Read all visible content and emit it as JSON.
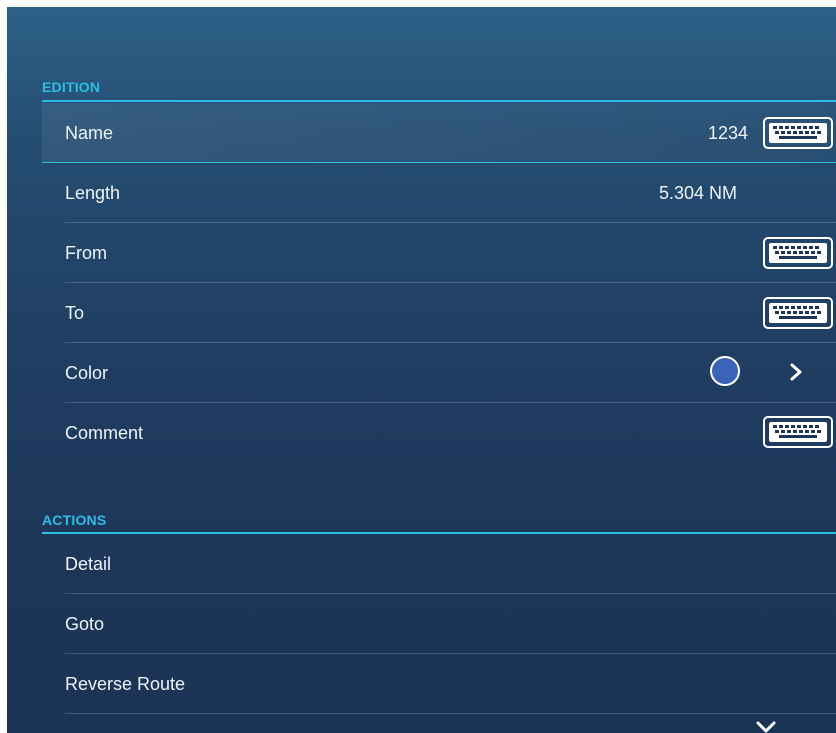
{
  "sections": {
    "edition": {
      "header": "EDITION",
      "rows": [
        {
          "label": "Name",
          "value": "1234",
          "control": "keyboard-icon"
        },
        {
          "label": "Length",
          "value": "5.304 NM"
        },
        {
          "label": "From",
          "control": "keyboard-icon"
        },
        {
          "label": "To",
          "control": "keyboard-icon"
        },
        {
          "label": "Color",
          "color": "#3b64b9",
          "control": "chevron-right-icon"
        },
        {
          "label": "Comment",
          "control": "keyboard-icon"
        }
      ]
    },
    "actions": {
      "header": "ACTIONS",
      "rows": [
        {
          "label": "Detail"
        },
        {
          "label": "Goto"
        },
        {
          "label": "Reverse Route"
        }
      ]
    }
  },
  "scroll_indicator": "chevron-down-icon",
  "colors": {
    "accent": "#2bbde4",
    "panel_top": "#2d6087",
    "panel_bottom": "#1b3354",
    "text": "#eef3f8"
  }
}
